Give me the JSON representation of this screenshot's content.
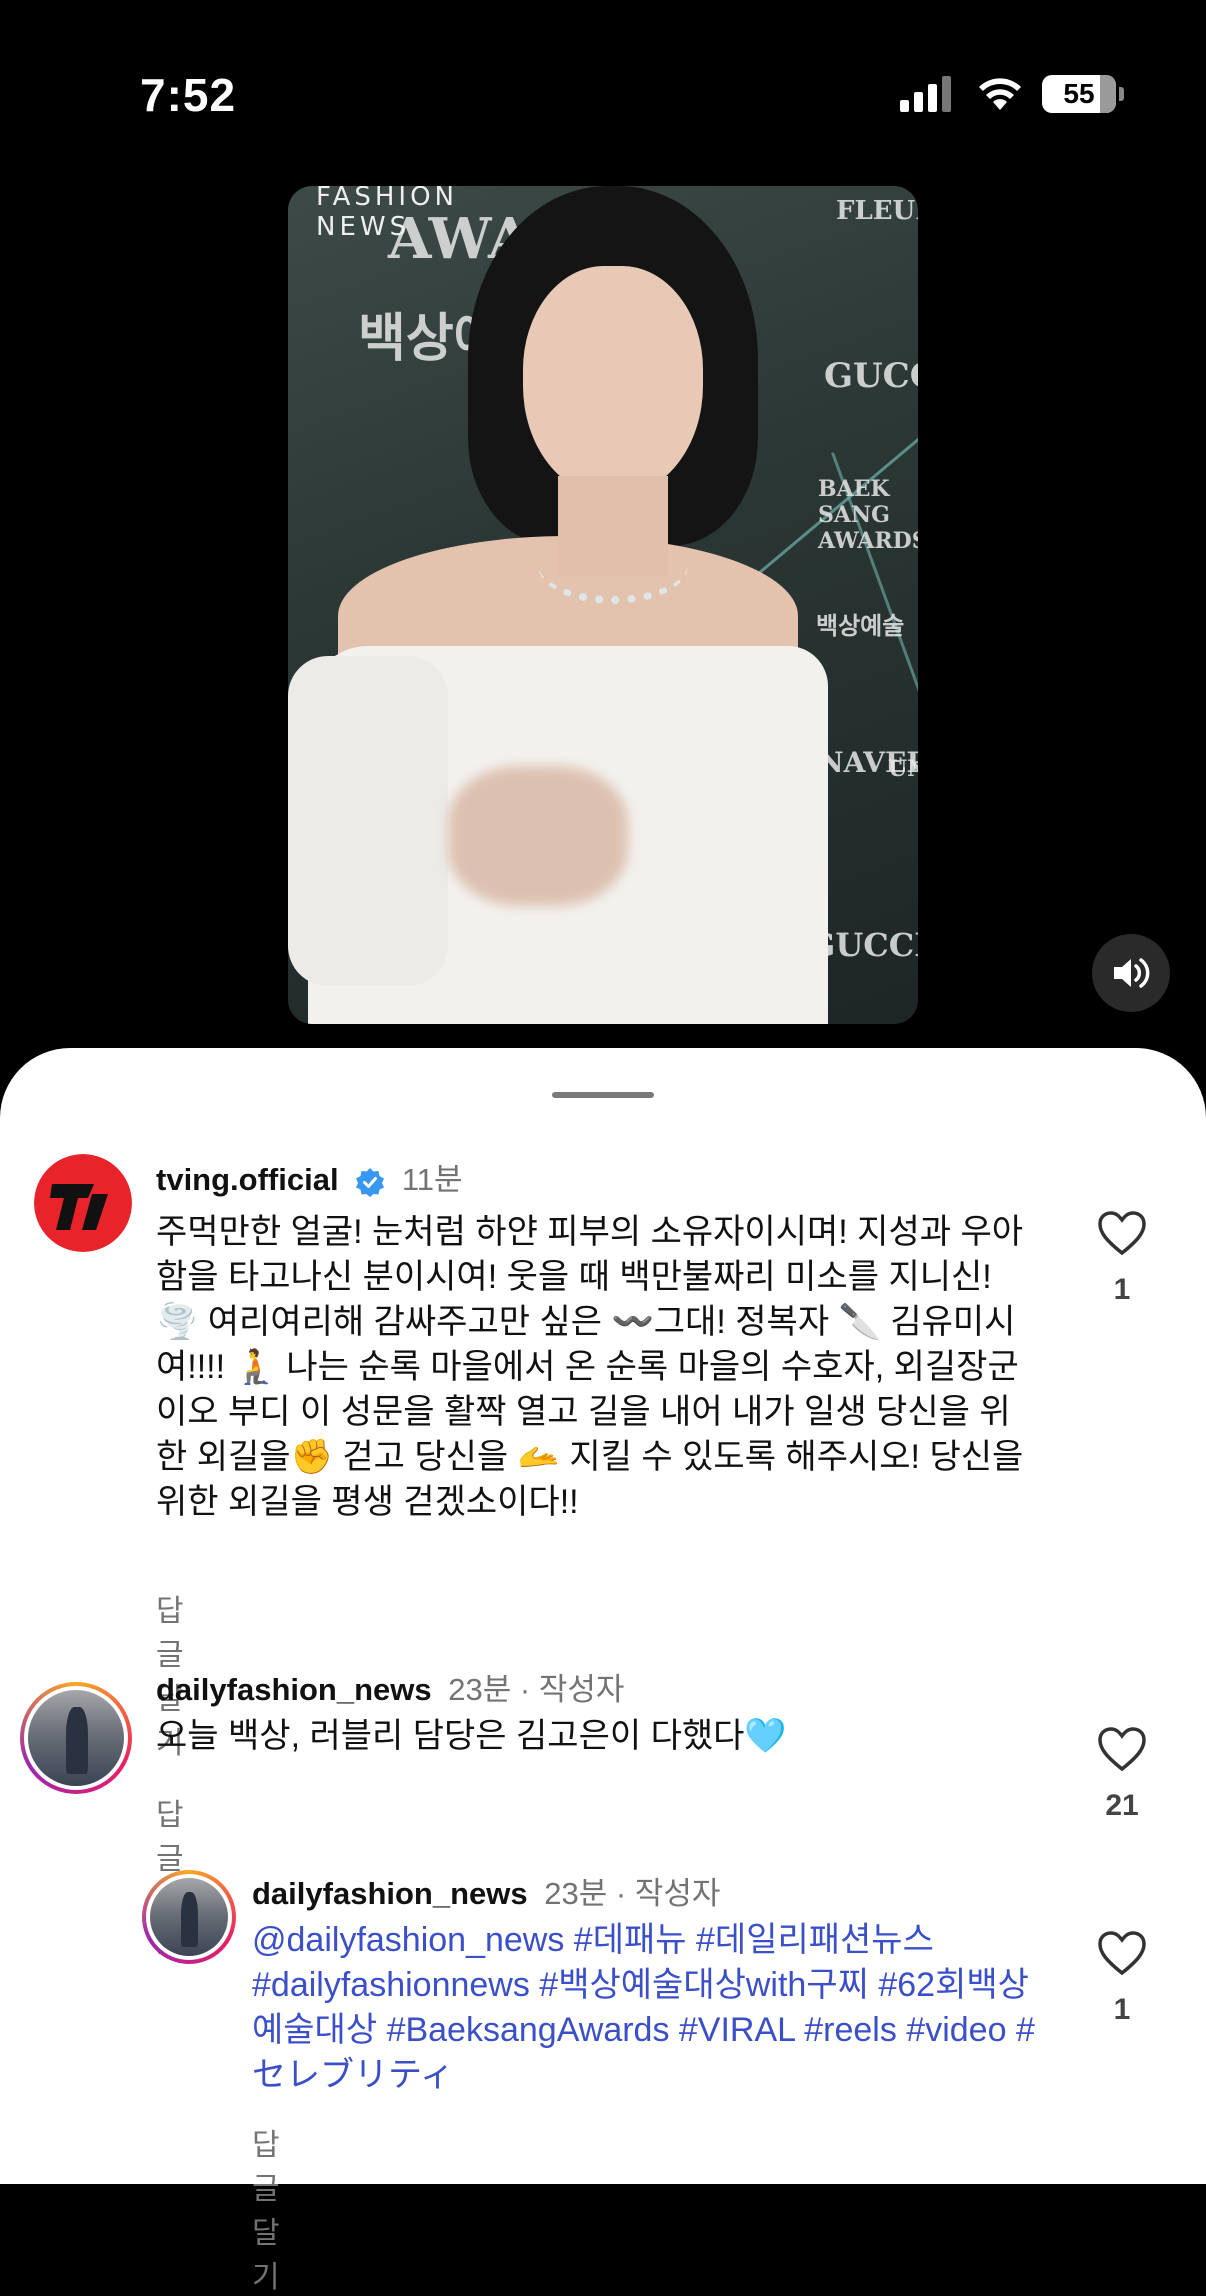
{
  "status_bar": {
    "time": "7:52",
    "battery": "55"
  },
  "video": {
    "logo": "FASHION\nNEWS",
    "backdrop_texts": [
      "AWARDS",
      "백상예술대",
      "FLEURE",
      "GUCCI",
      "BAEK SANG AWARDS",
      "백상예술",
      "NAVER",
      "GUCCI",
      "UNI"
    ],
    "sound_icon": "speaker-icon"
  },
  "comments": [
    {
      "username": "tving.official",
      "verified": true,
      "time": "11분",
      "text": "주먹만한 얼굴! 눈처럼 하얀 피부의 소유자이시며! 지성과 우아함을 타고나신 분이시여! 웃을 때 백만불짜리 미소를 지니신! 🌪️ 여리여리해 감싸주고만 싶은 〰️그대! 정복자 🔪 김유미시여!!!! 🧎 나는 순록 마을에서 온 순록 마을의 수호자, 외길장군이오 부디 이 성문을 활짝 열고 길을 내어 내가 일생 당신을 위한 외길을✊ 걷고 당신을 🫴 지킬 수 있도록 해주시오! 당신을 위한 외길을 평생 걷겠소이다!!",
      "reply_label": "답글 달기",
      "likes": "1"
    },
    {
      "username": "dailyfashion_news",
      "time": "23분",
      "author_tag": "· 작성자",
      "text": "오늘 백상, 러블리 담당은 김고은이 다했다🩵",
      "reply_label": "답글 달기",
      "likes": "21"
    },
    {
      "username": "dailyfashion_news",
      "time": "23분",
      "author_tag": "· 작성자",
      "text": "@dailyfashion_news #데패뉴 #데일리패션뉴스 #dailyfashionnews #백상예술대상with구찌 #62회백상예술대상 #BaeksangAwards #VIRAL #reels #video #セレブリティ",
      "reply_label": "답글 달기",
      "likes": "1"
    }
  ],
  "colors": {
    "link": "#3a4fc8",
    "verified": "#3897f0",
    "tving_red": "#e8232a"
  }
}
